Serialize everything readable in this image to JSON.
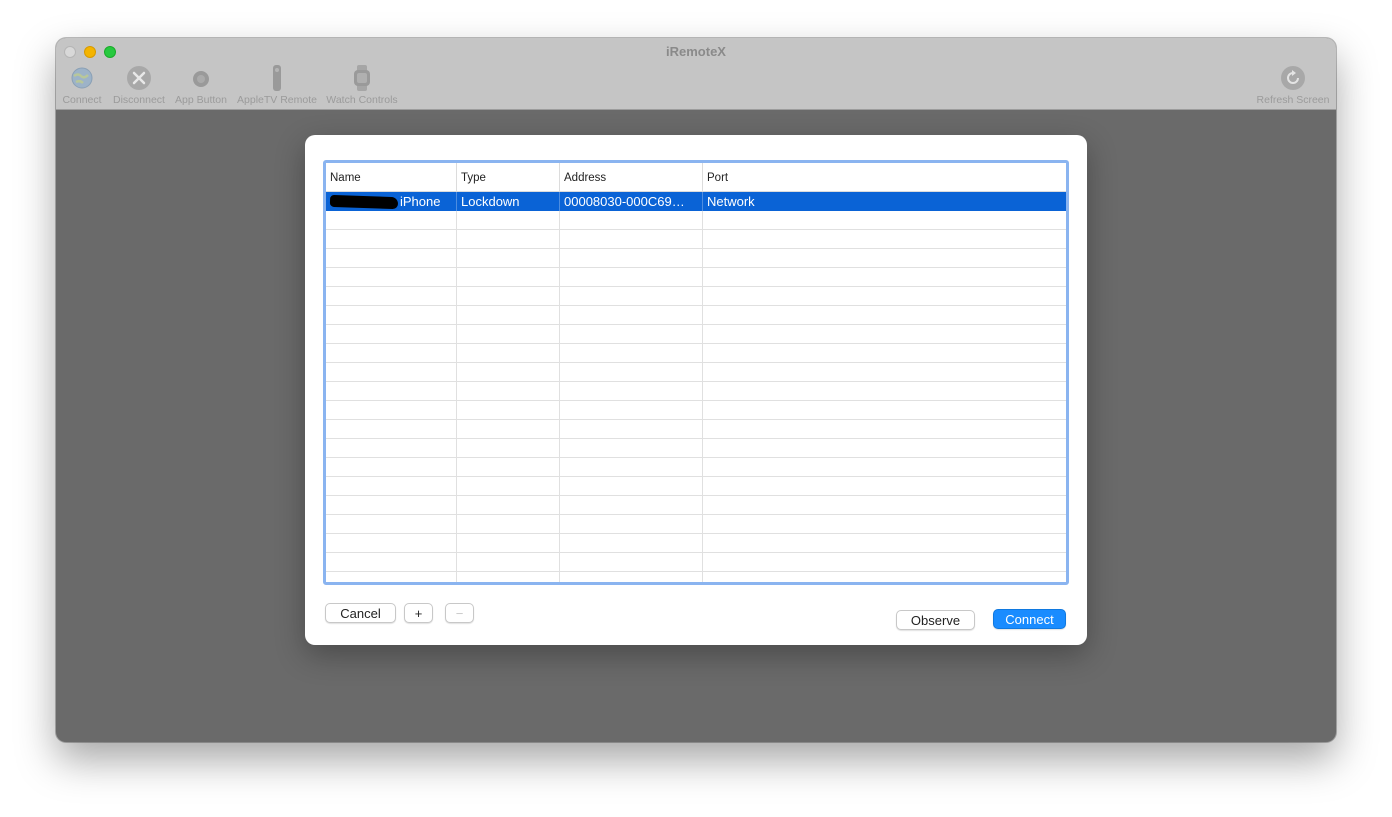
{
  "window": {
    "title": "iRemoteX"
  },
  "toolbar": {
    "connect_label": "Connect",
    "disconnect_label": "Disconnect",
    "app_button_label": "App Button",
    "appletv_remote_label": "AppleTV Remote",
    "watch_controls_label": "Watch Controls",
    "refresh_screen_label": "Refresh Screen",
    "icons": {
      "connect": "globe-icon",
      "disconnect": "x-circle-icon",
      "app_button": "circle-button-icon",
      "appletv_remote": "remote-icon",
      "watch_controls": "watch-icon",
      "refresh_screen": "refresh-icon"
    }
  },
  "dialog": {
    "table": {
      "columns": [
        "Name",
        "Type",
        "Address",
        "Port"
      ],
      "rows": [
        {
          "name": "iPhone",
          "type": "Lockdown",
          "address": "00008030-000C69…",
          "port": "Network",
          "selected": true
        }
      ]
    },
    "cancel_label": "Cancel",
    "add_label": "+",
    "remove_label": "−",
    "observe_label": "Observe",
    "connect_label": "Connect"
  },
  "colors": {
    "selection": "#0a63d6",
    "accent": "#1a8cff",
    "focus_ring": "#8ab4f0"
  }
}
